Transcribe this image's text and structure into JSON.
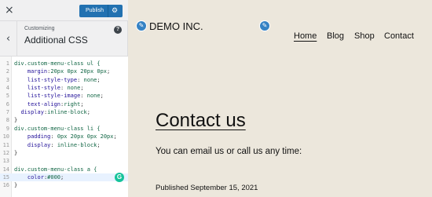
{
  "customizer": {
    "close_glyph": "×",
    "publish_label": "Publish",
    "gear_glyph": "⚙",
    "back_glyph": "‹",
    "breadcrumb": "Customizing",
    "section_title": "Additional CSS",
    "help_glyph": "?",
    "badge_glyph": "G"
  },
  "code_lines": [
    {
      "n": "1",
      "text": "div.custom-menu-class ul {"
    },
    {
      "n": "2",
      "text": "    margin:20px 0px 20px 0px;"
    },
    {
      "n": "3",
      "text": "    list-style-type: none;"
    },
    {
      "n": "4",
      "text": "    list-style: none;"
    },
    {
      "n": "5",
      "text": "    list-style-image: none;"
    },
    {
      "n": "6",
      "text": "    text-align:right;"
    },
    {
      "n": "7",
      "text": "  display:inline-block;"
    },
    {
      "n": "8",
      "text": "}"
    },
    {
      "n": "9",
      "text": "div.custom-menu-class li {"
    },
    {
      "n": "10",
      "text": "    padding: 0px 20px 0px 20px;"
    },
    {
      "n": "11",
      "text": "    display: inline-block;"
    },
    {
      "n": "12",
      "text": "}"
    },
    {
      "n": "13",
      "text": ""
    },
    {
      "n": "14",
      "text": "div.custom-menu-class a {"
    },
    {
      "n": "15",
      "text": "    color:#000;"
    },
    {
      "n": "16",
      "text": "}"
    }
  ],
  "preview": {
    "edit_glyph": "✎",
    "site_title": "DEMO INC.",
    "nav": [
      "Home",
      "Blog",
      "Shop",
      "Contact"
    ],
    "page_title": "Contact us",
    "intro": "You can email us or call us any time:",
    "published": "Published September 15, 2021"
  },
  "colors": {
    "accent": "#2271b1",
    "preview_bg": "#ece7dc",
    "edit_button": "#3582c4"
  }
}
